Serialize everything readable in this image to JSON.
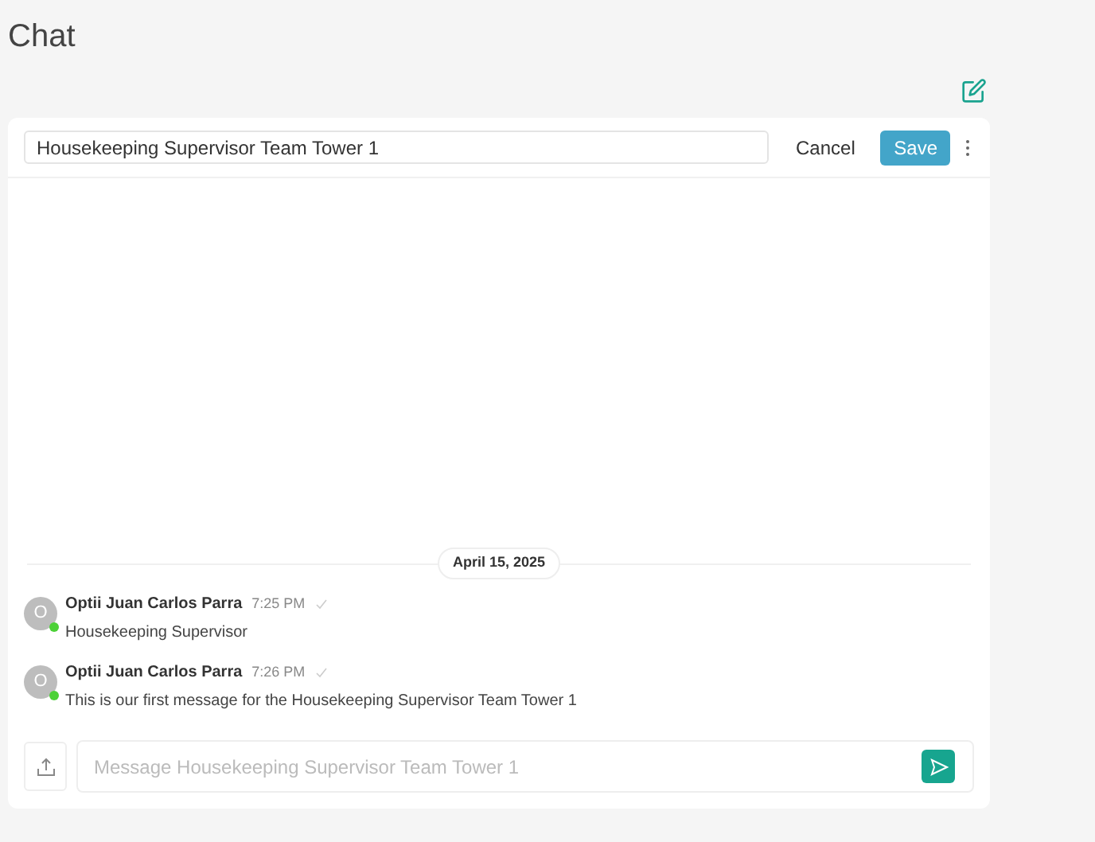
{
  "page": {
    "title": "Chat"
  },
  "header": {
    "name_value": "Housekeeping Supervisor Team Tower 1",
    "cancel": "Cancel",
    "save": "Save"
  },
  "date_divider": "April 15, 2025",
  "messages": [
    {
      "avatar": "O",
      "online": true,
      "author": "Optii Juan Carlos Parra",
      "time": "7:25 PM",
      "text": "Housekeeping Supervisor"
    },
    {
      "avatar": "O",
      "online": true,
      "author": "Optii Juan Carlos Parra",
      "time": "7:26 PM",
      "text": "This is our first message for the Housekeeping Supervisor Team Tower 1"
    }
  ],
  "composer": {
    "placeholder": "Message Housekeeping Supervisor Team Tower 1"
  }
}
